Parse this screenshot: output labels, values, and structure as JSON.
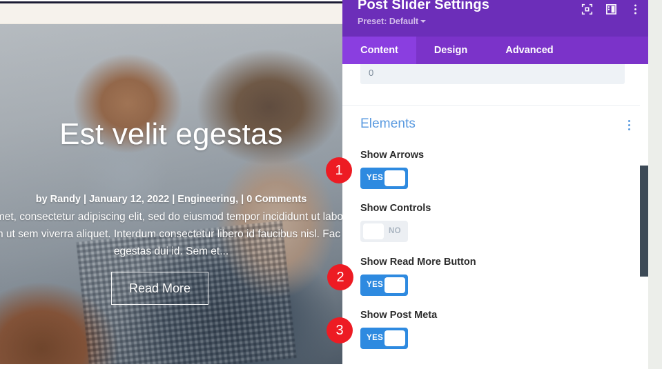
{
  "site_preview": {
    "hero": {
      "title": "Est velit egestas",
      "meta": "by Randy | January 12, 2022 | Engineering, | 0 Comments",
      "excerpt": "amet, consectetur adipiscing elit, sed do eiusmod tempor incididunt ut labore enim ut sem viverra aliquet. Interdum consectetur libero id faucibus nisl. Fac velit egestas dui id. Sem et...",
      "read_more_label": "Read More"
    }
  },
  "settings_panel": {
    "title": "Post Slider Settings",
    "preset_label": "Preset: Default",
    "header_icons": [
      {
        "name": "focus-target-icon"
      },
      {
        "name": "layout-panel-icon"
      },
      {
        "name": "more-options-icon"
      }
    ],
    "tabs": [
      {
        "label": "Content",
        "active": true
      },
      {
        "label": "Design",
        "active": false
      },
      {
        "label": "Advanced",
        "active": false
      }
    ],
    "number_field": {
      "value": "0",
      "placeholder": "0"
    },
    "sections": [
      {
        "title": "Elements",
        "fields": [
          {
            "label": "Show Arrows",
            "toggle_state": "YES",
            "on": true
          },
          {
            "label": "Show Controls",
            "toggle_state": "NO",
            "on": false
          },
          {
            "label": "Show Read More Button",
            "toggle_state": "YES",
            "on": true
          },
          {
            "label": "Show Post Meta",
            "toggle_state": "YES",
            "on": true
          }
        ]
      }
    ]
  },
  "annotations": [
    {
      "number": "1"
    },
    {
      "number": "2"
    },
    {
      "number": "3"
    }
  ],
  "colors": {
    "panel_header_purple": "#6c2eb9",
    "tab_bar_purple": "#7b33c9",
    "tab_active_purple": "#8a3ee0",
    "toggle_on_blue": "#2e8ae0",
    "toggle_off_gray": "#eceff3",
    "section_title_blue": "#5a9ae0",
    "badge_red": "#ed1b23",
    "scrollbar_thumb": "#3d4a57"
  }
}
